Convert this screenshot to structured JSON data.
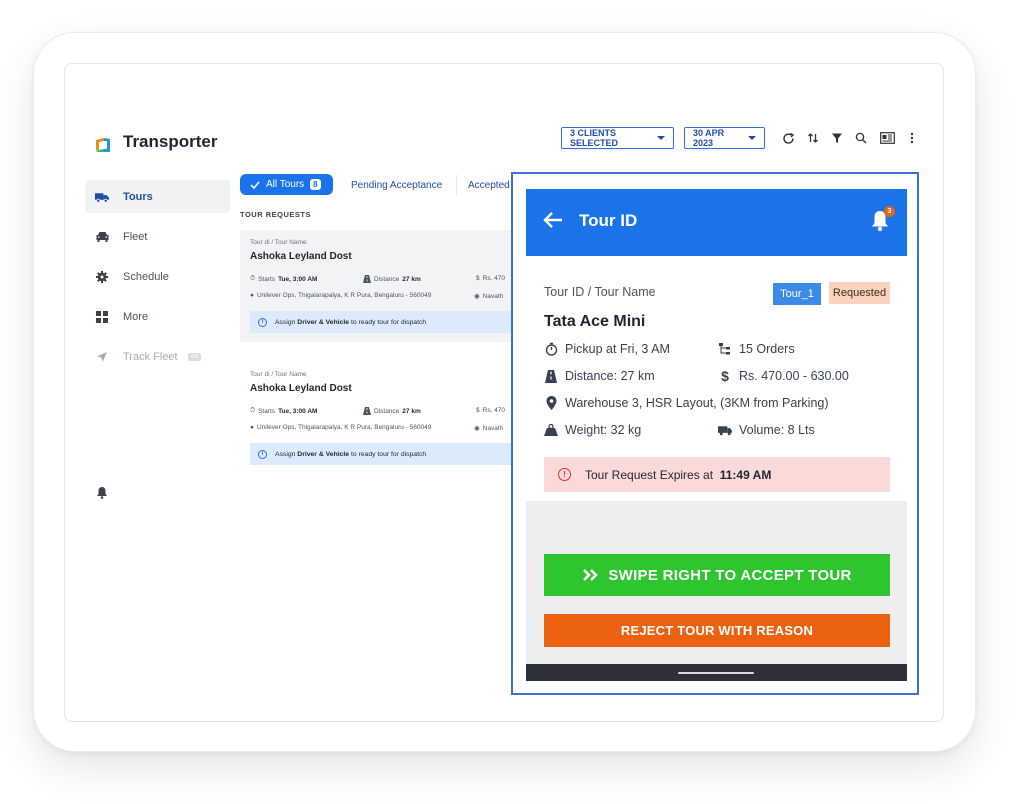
{
  "app": {
    "title": "Transporter"
  },
  "header": {
    "clients_label": "3 CLIENTS SELECTED",
    "date_label": "30 APR 2023"
  },
  "sidebar": {
    "items": [
      {
        "label": "Tours",
        "icon": "truck-icon"
      },
      {
        "label": "Fleet",
        "icon": "car-icon"
      },
      {
        "label": "Schedule",
        "icon": "gear-icon"
      },
      {
        "label": "More",
        "icon": "grid-icon"
      },
      {
        "label": "Track Fleet",
        "icon": "navigation-icon",
        "badge": "Ad"
      }
    ]
  },
  "tabs": [
    {
      "label": "All Tours",
      "count": "8"
    },
    {
      "label": "Pending Acceptance"
    },
    {
      "label": "Accepted"
    }
  ],
  "section_label": "TOUR REQUESTS",
  "tour_cards": [
    {
      "subtitle": "Tour di / Tour Name",
      "title": "Ashoka Leyland Dost",
      "starts_prefix": "Starts",
      "starts_value": "Tue, 3:00 AM",
      "distance_prefix": "Distance",
      "distance_value": "27 km",
      "price": "Rs. 470",
      "location": "Unilever Ops, Thigalarapalya, K R Pura, Bengaluru - 560049",
      "location2": "Navath",
      "assign_prefix": "Assign",
      "assign_bold": "Driver & Vehicle",
      "assign_suffix": "to ready tour for dispatch"
    },
    {
      "subtitle": "Tour di / Tour Name",
      "title": "Ashoka Leyland Dost",
      "starts_prefix": "Starts",
      "starts_value": "Tue, 3:00 AM",
      "distance_prefix": "Distance",
      "distance_value": "27 km",
      "price": "Rs. 470",
      "location": "Unilever Ops, Thigalarapalya, K R Pura, Bengaluru - 560049",
      "location2": "Navath",
      "assign_prefix": "Assign",
      "assign_bold": "Driver & Vehicle",
      "assign_suffix": "to ready tour for dispatch"
    }
  ],
  "panel": {
    "title": "Tour ID",
    "notification_count": "3",
    "label": "Tour ID / Tour Name",
    "tour_badge": "Tour_1",
    "status_badge": "Requested",
    "name": "Tata Ace Mini",
    "pickup": "Pickup at Fri, 3 AM",
    "orders": "15 Orders",
    "distance": "Distance: 27 km",
    "price": "Rs. 470.00 - 630.00",
    "location": "Warehouse 3, HSR Layout,  (3KM from Parking)",
    "weight": "Weight: 32 kg",
    "volume": "Volume: 8 Lts",
    "expiry_text": "Tour Request Expires at",
    "expiry_time": "11:49 AM",
    "accept_label": "SWIPE RIGHT TO ACCEPT TOUR",
    "reject_label": "REJECT TOUR WITH REASON"
  },
  "colors": {
    "primary": "#1a73e8",
    "accept": "#2fc52f",
    "reject": "#ea6210",
    "expiry_bg": "#fbd9d8",
    "requested_bg": "#fbd2bd"
  }
}
